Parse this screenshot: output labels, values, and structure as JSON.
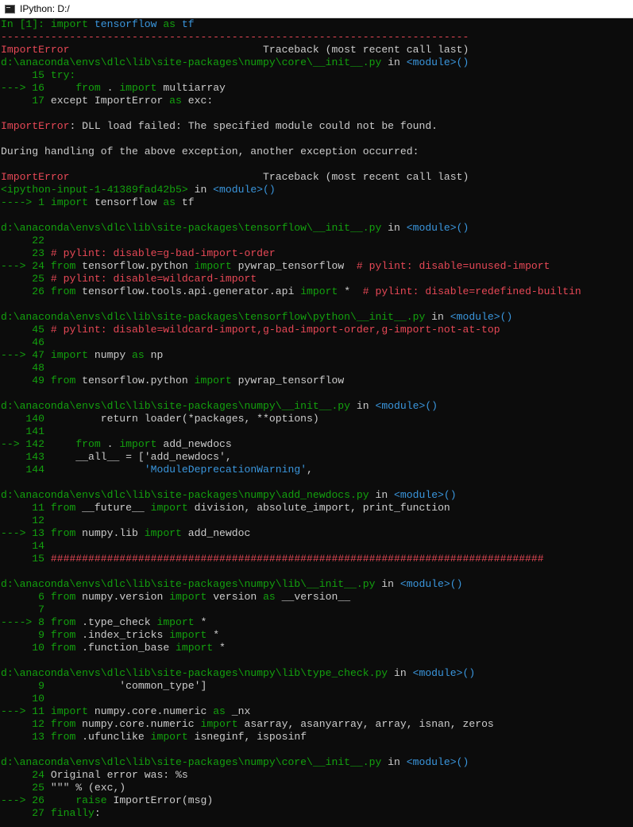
{
  "window": {
    "title": "IPython: D:/",
    "icon": "terminal-icon"
  },
  "colors": {
    "background": "#0c0c0c",
    "foreground": "#cccccc",
    "green": "#13a10e",
    "red": "#e74856",
    "teal": "#3a96dd"
  },
  "console_lines": [
    [
      [
        "g",
        "In [1]: "
      ],
      [
        "g",
        "import "
      ],
      [
        "t",
        "tensorflow"
      ],
      [
        "g",
        " as "
      ],
      [
        "t",
        "tf"
      ]
    ],
    [
      [
        "r",
        "---------------------------------------------------------------------------"
      ]
    ],
    [
      [
        "r",
        "ImportError"
      ],
      [
        "f",
        "                               Traceback (most recent call last)"
      ]
    ],
    [
      [
        "g",
        "d:\\anaconda\\envs\\dlc\\lib\\site-packages\\numpy\\core\\__init__.py"
      ],
      [
        "f",
        " in "
      ],
      [
        "t",
        "<module>()"
      ]
    ],
    [
      [
        "g",
        "     15 try:"
      ]
    ],
    [
      [
        "g",
        "---> 16 "
      ],
      [
        "f",
        "    "
      ],
      [
        "g",
        "from"
      ],
      [
        "f",
        " . "
      ],
      [
        "g",
        "import"
      ],
      [
        "f",
        " multiarray"
      ]
    ],
    [
      [
        "g",
        "     17 "
      ],
      [
        "f",
        "except ImportError "
      ],
      [
        "g",
        "as"
      ],
      [
        "f",
        " exc:"
      ]
    ],
    [],
    [
      [
        "r",
        "ImportError"
      ],
      [
        "f",
        ": DLL load failed: The specified module could not be found."
      ]
    ],
    [],
    [
      [
        "f",
        "During handling of the above exception, another exception occurred:"
      ]
    ],
    [],
    [
      [
        "r",
        "ImportError"
      ],
      [
        "f",
        "                               Traceback (most recent call last)"
      ]
    ],
    [
      [
        "g",
        "<ipython-input-1-41389fad42b5>"
      ],
      [
        "f",
        " in "
      ],
      [
        "t",
        "<module>()"
      ]
    ],
    [
      [
        "g",
        "----> 1 "
      ],
      [
        "g",
        "import"
      ],
      [
        "f",
        " tensorflow "
      ],
      [
        "g",
        "as"
      ],
      [
        "f",
        " tf"
      ]
    ],
    [],
    [
      [
        "g",
        "d:\\anaconda\\envs\\dlc\\lib\\site-packages\\tensorflow\\__init__.py"
      ],
      [
        "f",
        " in "
      ],
      [
        "t",
        "<module>()"
      ]
    ],
    [
      [
        "g",
        "     22"
      ]
    ],
    [
      [
        "g",
        "     23 "
      ],
      [
        "r",
        "# pylint: disable=g-bad-import-order"
      ]
    ],
    [
      [
        "g",
        "---> 24 "
      ],
      [
        "g",
        "from"
      ],
      [
        "f",
        " tensorflow.python "
      ],
      [
        "g",
        "import"
      ],
      [
        "f",
        " pywrap_tensorflow  "
      ],
      [
        "r",
        "# pylint: disable=unused-import"
      ]
    ],
    [
      [
        "g",
        "     25 "
      ],
      [
        "r",
        "# pylint: disable=wildcard-import"
      ]
    ],
    [
      [
        "g",
        "     26 "
      ],
      [
        "g",
        "from"
      ],
      [
        "f",
        " tensorflow.tools.api.generator.api "
      ],
      [
        "g",
        "import"
      ],
      [
        "f",
        " *  "
      ],
      [
        "r",
        "# pylint: disable=redefined-builtin"
      ]
    ],
    [],
    [
      [
        "g",
        "d:\\anaconda\\envs\\dlc\\lib\\site-packages\\tensorflow\\python\\__init__.py"
      ],
      [
        "f",
        " in "
      ],
      [
        "t",
        "<module>()"
      ]
    ],
    [
      [
        "g",
        "     45 "
      ],
      [
        "r",
        "# pylint: disable=wildcard-import,g-bad-import-order,g-import-not-at-top"
      ]
    ],
    [
      [
        "g",
        "     46"
      ]
    ],
    [
      [
        "g",
        "---> 47 "
      ],
      [
        "g",
        "import"
      ],
      [
        "f",
        " numpy "
      ],
      [
        "g",
        "as"
      ],
      [
        "f",
        " np"
      ]
    ],
    [
      [
        "g",
        "     48"
      ]
    ],
    [
      [
        "g",
        "     49 "
      ],
      [
        "g",
        "from"
      ],
      [
        "f",
        " tensorflow.python "
      ],
      [
        "g",
        "import"
      ],
      [
        "f",
        " pywrap_tensorflow"
      ]
    ],
    [],
    [
      [
        "g",
        "d:\\anaconda\\envs\\dlc\\lib\\site-packages\\numpy\\__init__.py"
      ],
      [
        "f",
        " in "
      ],
      [
        "t",
        "<module>()"
      ]
    ],
    [
      [
        "g",
        "    140 "
      ],
      [
        "f",
        "        return loader(*packages, **options)"
      ]
    ],
    [
      [
        "g",
        "    141"
      ]
    ],
    [
      [
        "g",
        "--> 142 "
      ],
      [
        "f",
        "    "
      ],
      [
        "g",
        "from"
      ],
      [
        "f",
        " . "
      ],
      [
        "g",
        "import"
      ],
      [
        "f",
        " add_newdocs"
      ]
    ],
    [
      [
        "g",
        "    143 "
      ],
      [
        "f",
        "    __all__ = ['add_newdocs',"
      ]
    ],
    [
      [
        "g",
        "    144 "
      ],
      [
        "f",
        "               "
      ],
      [
        "t",
        "'ModuleDeprecationWarning'"
      ],
      [
        "f",
        ","
      ]
    ],
    [],
    [
      [
        "g",
        "d:\\anaconda\\envs\\dlc\\lib\\site-packages\\numpy\\add_newdocs.py"
      ],
      [
        "f",
        " in "
      ],
      [
        "t",
        "<module>()"
      ]
    ],
    [
      [
        "g",
        "     11 "
      ],
      [
        "g",
        "from"
      ],
      [
        "f",
        " __future__ "
      ],
      [
        "g",
        "import"
      ],
      [
        "f",
        " division, absolute_import, print_function"
      ]
    ],
    [
      [
        "g",
        "     12"
      ]
    ],
    [
      [
        "g",
        "---> 13 "
      ],
      [
        "g",
        "from"
      ],
      [
        "f",
        " numpy.lib "
      ],
      [
        "g",
        "import"
      ],
      [
        "f",
        " add_newdoc"
      ]
    ],
    [
      [
        "g",
        "     14"
      ]
    ],
    [
      [
        "g",
        "     15 "
      ],
      [
        "r",
        "###############################################################################"
      ]
    ],
    [],
    [
      [
        "g",
        "d:\\anaconda\\envs\\dlc\\lib\\site-packages\\numpy\\lib\\__init__.py"
      ],
      [
        "f",
        " in "
      ],
      [
        "t",
        "<module>()"
      ]
    ],
    [
      [
        "g",
        "      6 "
      ],
      [
        "g",
        "from"
      ],
      [
        "f",
        " numpy.version "
      ],
      [
        "g",
        "import"
      ],
      [
        "f",
        " version "
      ],
      [
        "g",
        "as"
      ],
      [
        "f",
        " __version__"
      ]
    ],
    [
      [
        "g",
        "      7"
      ]
    ],
    [
      [
        "g",
        "----> 8 "
      ],
      [
        "g",
        "from"
      ],
      [
        "f",
        " .type_check "
      ],
      [
        "g",
        "import"
      ],
      [
        "f",
        " *"
      ]
    ],
    [
      [
        "g",
        "      9 "
      ],
      [
        "g",
        "from"
      ],
      [
        "f",
        " .index_tricks "
      ],
      [
        "g",
        "import"
      ],
      [
        "f",
        " *"
      ]
    ],
    [
      [
        "g",
        "     10 "
      ],
      [
        "g",
        "from"
      ],
      [
        "f",
        " .function_base "
      ],
      [
        "g",
        "import"
      ],
      [
        "f",
        " *"
      ]
    ],
    [],
    [
      [
        "g",
        "d:\\anaconda\\envs\\dlc\\lib\\site-packages\\numpy\\lib\\type_check.py"
      ],
      [
        "f",
        " in "
      ],
      [
        "t",
        "<module>()"
      ]
    ],
    [
      [
        "g",
        "      9 "
      ],
      [
        "f",
        "           'common_type']"
      ]
    ],
    [
      [
        "g",
        "     10"
      ]
    ],
    [
      [
        "g",
        "---> 11 "
      ],
      [
        "g",
        "import"
      ],
      [
        "f",
        " numpy.core.numeric "
      ],
      [
        "g",
        "as"
      ],
      [
        "f",
        " _nx"
      ]
    ],
    [
      [
        "g",
        "     12 "
      ],
      [
        "g",
        "from"
      ],
      [
        "f",
        " numpy.core.numeric "
      ],
      [
        "g",
        "import"
      ],
      [
        "f",
        " asarray, asanyarray, array, isnan, zeros"
      ]
    ],
    [
      [
        "g",
        "     13 "
      ],
      [
        "g",
        "from"
      ],
      [
        "f",
        " .ufunclike "
      ],
      [
        "g",
        "import"
      ],
      [
        "f",
        " isneginf, isposinf"
      ]
    ],
    [],
    [
      [
        "g",
        "d:\\anaconda\\envs\\dlc\\lib\\site-packages\\numpy\\core\\__init__.py"
      ],
      [
        "f",
        " in "
      ],
      [
        "t",
        "<module>()"
      ]
    ],
    [
      [
        "g",
        "     24 "
      ],
      [
        "f",
        "Original error was: %s"
      ]
    ],
    [
      [
        "g",
        "     25 "
      ],
      [
        "f",
        "\"\"\" % (exc,)"
      ]
    ],
    [
      [
        "g",
        "---> 26 "
      ],
      [
        "f",
        "    "
      ],
      [
        "g",
        "raise"
      ],
      [
        "f",
        " ImportError(msg)"
      ]
    ],
    [
      [
        "g",
        "     27 "
      ],
      [
        "g",
        "finally"
      ],
      [
        "f",
        ":"
      ]
    ]
  ]
}
